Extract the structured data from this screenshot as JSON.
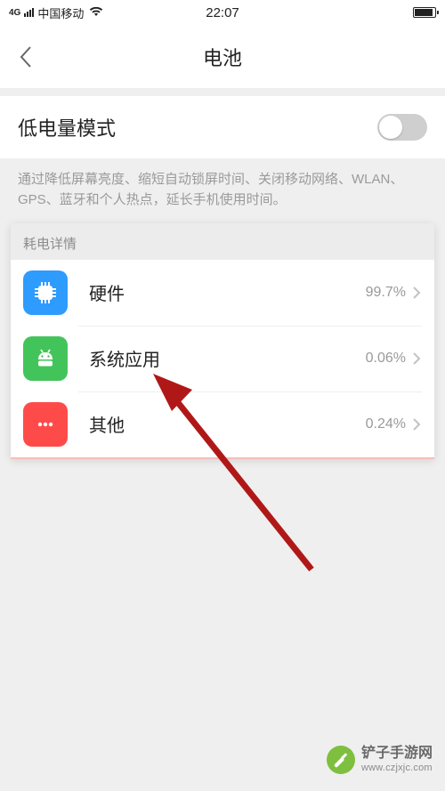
{
  "status_bar": {
    "network_badge": "4G",
    "carrier": "中国移动",
    "time": "22:07"
  },
  "nav": {
    "title": "电池"
  },
  "low_power": {
    "label": "低电量模式",
    "toggle_on": false,
    "description": "通过降低屏幕亮度、缩短自动锁屏时间、关闭移动网络、WLAN、GPS、蓝牙和个人热点，延长手机使用时间。"
  },
  "usage": {
    "header": "耗电详情",
    "rows": [
      {
        "icon": "hardware",
        "label": "硬件",
        "value": "99.7%"
      },
      {
        "icon": "system",
        "label": "系统应用",
        "value": "0.06%"
      },
      {
        "icon": "other",
        "label": "其他",
        "value": "0.24%"
      }
    ]
  },
  "watermark": {
    "name": "铲子手游网",
    "url": "www.czjxjc.com"
  }
}
